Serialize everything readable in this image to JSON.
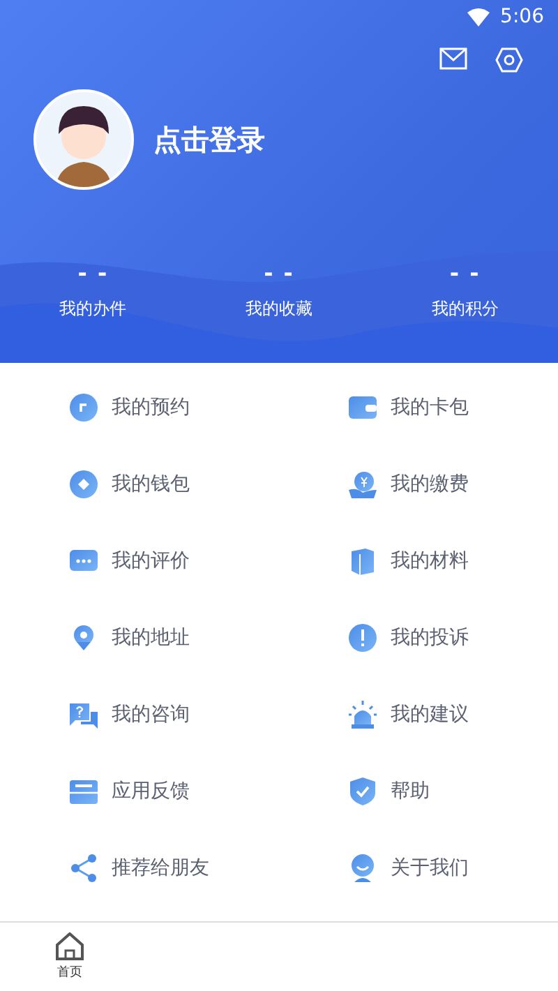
{
  "status_bar": {
    "time": "5:06"
  },
  "profile": {
    "login_text": "点击登录"
  },
  "stats": [
    {
      "value": "- -",
      "label": "我的办件"
    },
    {
      "value": "- -",
      "label": "我的收藏"
    },
    {
      "value": "- -",
      "label": "我的积分"
    }
  ],
  "menu": [
    {
      "label": "我的预约"
    },
    {
      "label": "我的卡包"
    },
    {
      "label": "我的钱包"
    },
    {
      "label": "我的缴费"
    },
    {
      "label": "我的评价"
    },
    {
      "label": "我的材料"
    },
    {
      "label": "我的地址"
    },
    {
      "label": "我的投诉"
    },
    {
      "label": "我的咨询"
    },
    {
      "label": "我的建议"
    },
    {
      "label": "应用反馈"
    },
    {
      "label": "帮助"
    },
    {
      "label": "推荐给朋友"
    },
    {
      "label": "关于我们"
    }
  ],
  "bottom_nav": [
    {
      "label": "首页"
    }
  ]
}
